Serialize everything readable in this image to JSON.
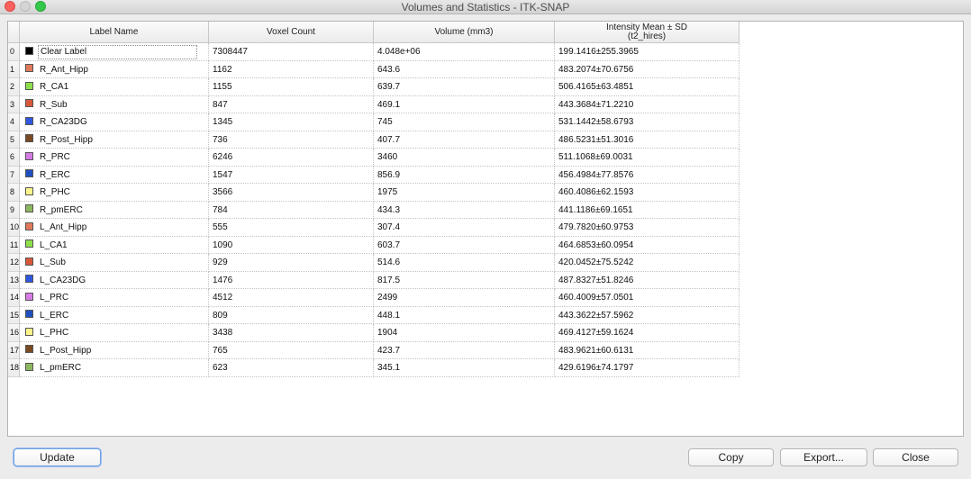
{
  "window": {
    "title": "Volumes and Statistics - ITK-SNAP"
  },
  "table": {
    "headers": {
      "label_name": "Label Name",
      "voxel_count": "Voxel Count",
      "volume": "Volume (mm3)",
      "intensity_line1": "Intensity Mean ± SD",
      "intensity_line2": "(t2_hires)"
    },
    "rows": [
      {
        "index": "0",
        "color": "#000000",
        "name": "Clear Label",
        "voxels": "7308447",
        "volume": "4.048e+06",
        "intensity": "199.1416±255.3965"
      },
      {
        "index": "1",
        "color": "#e07a5a",
        "name": "R_Ant_Hipp",
        "voxels": "1162",
        "volume": "643.6",
        "intensity": "483.2074±70.6756"
      },
      {
        "index": "2",
        "color": "#8ee04a",
        "name": "R_CA1",
        "voxels": "1155",
        "volume": "639.7",
        "intensity": "506.4165±63.4851"
      },
      {
        "index": "3",
        "color": "#d9583a",
        "name": "R_Sub",
        "voxels": "847",
        "volume": "469.1",
        "intensity": "443.3684±71.2210"
      },
      {
        "index": "4",
        "color": "#2f57e0",
        "name": "R_CA23DG",
        "voxels": "1345",
        "volume": "745",
        "intensity": "531.1442±58.6793"
      },
      {
        "index": "5",
        "color": "#7a4a22",
        "name": "R_Post_Hipp",
        "voxels": "736",
        "volume": "407.7",
        "intensity": "486.5231±51.3016"
      },
      {
        "index": "6",
        "color": "#d77be6",
        "name": "R_PRC",
        "voxels": "6246",
        "volume": "3460",
        "intensity": "511.1068±69.0031"
      },
      {
        "index": "7",
        "color": "#1f4fc0",
        "name": "R_ERC",
        "voxels": "1547",
        "volume": "856.9",
        "intensity": "456.4984±77.8576"
      },
      {
        "index": "8",
        "color": "#fbf58a",
        "name": "R_PHC",
        "voxels": "3566",
        "volume": "1975",
        "intensity": "460.4086±62.1593"
      },
      {
        "index": "9",
        "color": "#8cb862",
        "name": "R_pmERC",
        "voxels": "784",
        "volume": "434.3",
        "intensity": "441.1186±69.1651"
      },
      {
        "index": "10",
        "color": "#e07a5a",
        "name": "L_Ant_Hipp",
        "voxels": "555",
        "volume": "307.4",
        "intensity": "479.7820±60.9753"
      },
      {
        "index": "11",
        "color": "#8ee04a",
        "name": "L_CA1",
        "voxels": "1090",
        "volume": "603.7",
        "intensity": "464.6853±60.0954"
      },
      {
        "index": "12",
        "color": "#d9583a",
        "name": "L_Sub",
        "voxels": "929",
        "volume": "514.6",
        "intensity": "420.0452±75.5242"
      },
      {
        "index": "13",
        "color": "#2f57e0",
        "name": "L_CA23DG",
        "voxels": "1476",
        "volume": "817.5",
        "intensity": "487.8327±51.8246"
      },
      {
        "index": "14",
        "color": "#d77be6",
        "name": "L_PRC",
        "voxels": "4512",
        "volume": "2499",
        "intensity": "460.4009±57.0501"
      },
      {
        "index": "15",
        "color": "#1f4fc0",
        "name": "L_ERC",
        "voxels": "809",
        "volume": "448.1",
        "intensity": "443.3622±57.5962"
      },
      {
        "index": "16",
        "color": "#fbf58a",
        "name": "L_PHC",
        "voxels": "3438",
        "volume": "1904",
        "intensity": "469.4127±59.1624"
      },
      {
        "index": "17",
        "color": "#7a4a22",
        "name": "L_Post_Hipp",
        "voxels": "765",
        "volume": "423.7",
        "intensity": "483.9621±60.6131"
      },
      {
        "index": "18",
        "color": "#8cb862",
        "name": "L_pmERC",
        "voxels": "623",
        "volume": "345.1",
        "intensity": "429.6196±74.1797"
      }
    ]
  },
  "buttons": {
    "update": "Update",
    "copy": "Copy",
    "export": "Export...",
    "close": "Close"
  }
}
